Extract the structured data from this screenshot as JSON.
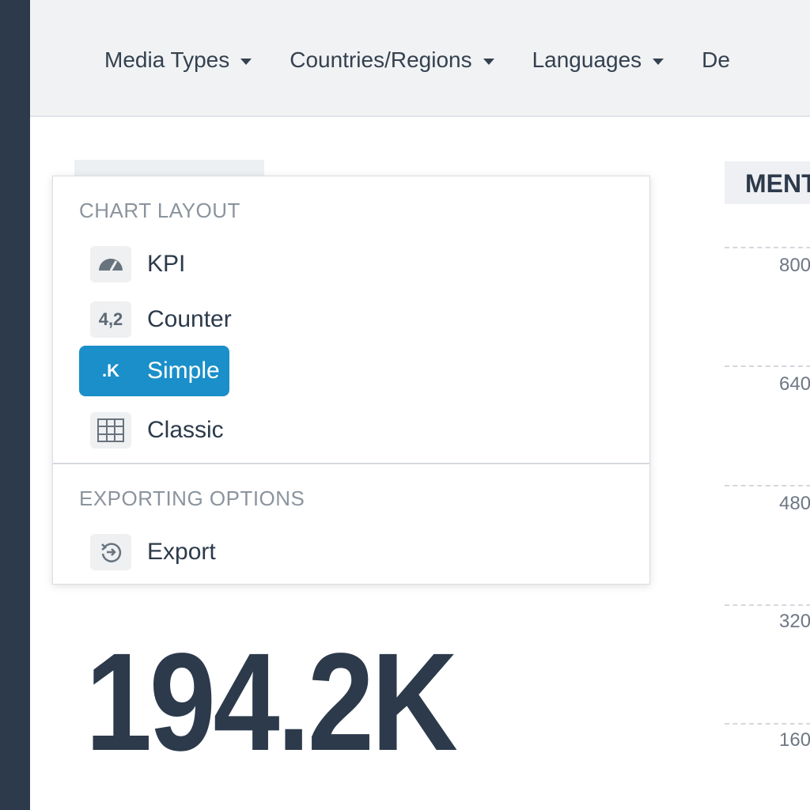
{
  "filters": [
    {
      "label": "Media Types"
    },
    {
      "label": "Countries/Regions"
    },
    {
      "label": "Languages"
    },
    {
      "label": "De"
    }
  ],
  "right_panel": {
    "title": "MENT",
    "ticks": [
      "800",
      "640",
      "480",
      "320",
      "160"
    ]
  },
  "kpi": {
    "value": "194.2K"
  },
  "menu": {
    "chart_layout_header": "CHART LAYOUT",
    "items": [
      {
        "label": "KPI",
        "icon": "gauge-icon"
      },
      {
        "label": "Counter",
        "icon": "counter-icon",
        "icon_text": "4,2"
      },
      {
        "label": "Simple",
        "icon": "simple-icon",
        "icon_text": ".K",
        "selected": true
      },
      {
        "label": "Classic",
        "icon": "grid-icon"
      }
    ],
    "exporting_header": "EXPORTING OPTIONS",
    "export_label": "Export",
    "export_icon": "export-icon"
  },
  "colors": {
    "accent": "#1a8fc9",
    "dark_navy": "#2c3a4b",
    "topbar_bg": "#f1f2f4"
  }
}
